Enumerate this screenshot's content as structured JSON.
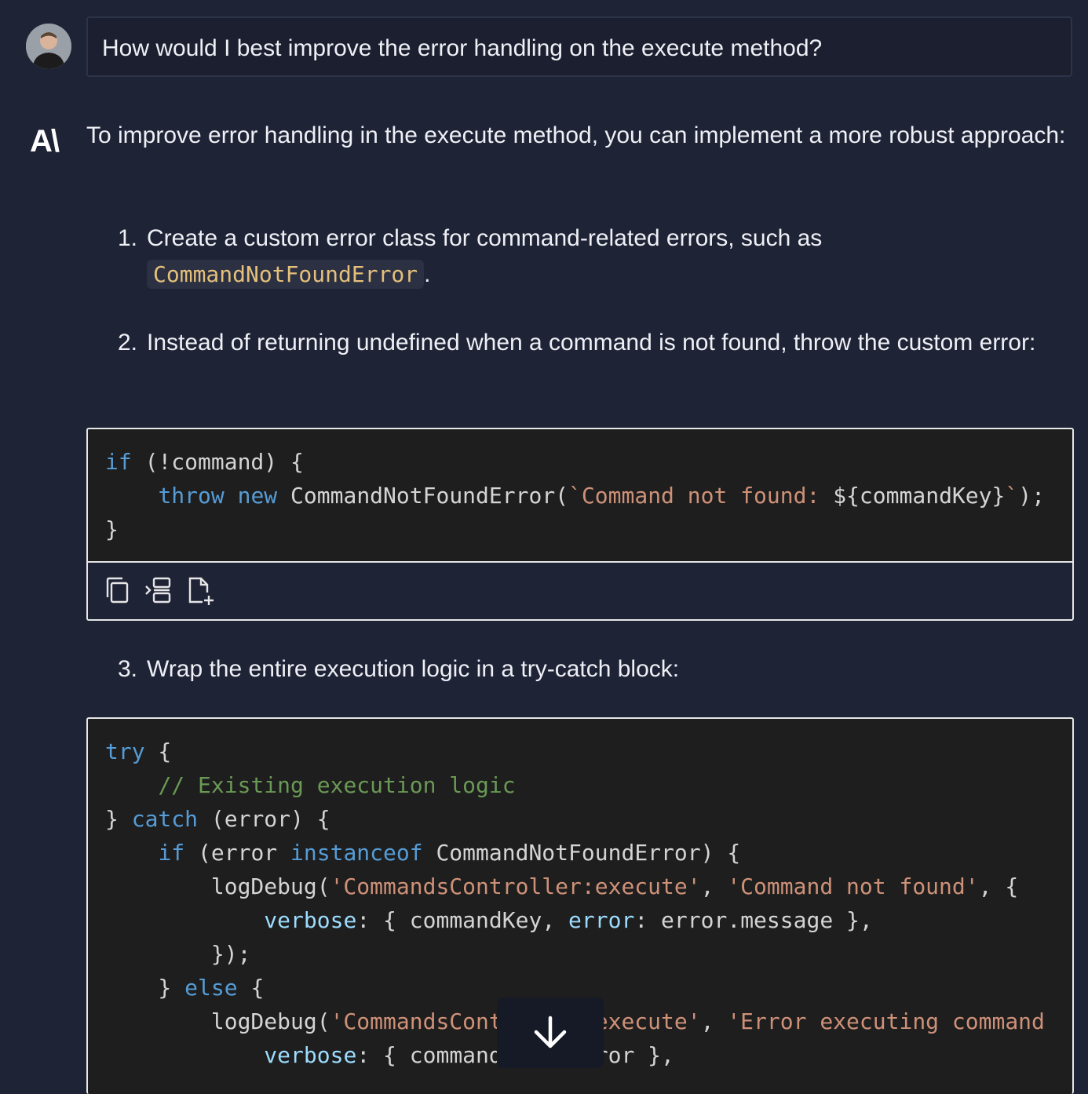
{
  "user": {
    "message": "How would I best improve the error handling on the execute method?"
  },
  "assistant": {
    "logo": "A\\",
    "intro": "To improve error handling in the execute method, you can implement a more robust approach:",
    "steps": [
      {
        "number": "1.",
        "text": "Create a custom error class for command-related errors, such as",
        "code": "CommandNotFoundError",
        "suffix": "."
      },
      {
        "number": "2.",
        "text": "Instead of returning undefined when a command is not found, throw the custom error:"
      },
      {
        "number": "3.",
        "text": "Wrap the entire execution logic in a try-catch block:"
      }
    ]
  },
  "code_blocks": [
    {
      "lines": [
        "if (!command) {",
        "    throw new CommandNotFoundError(`Command not found: ${commandKey}`);",
        "}"
      ],
      "toolbar": [
        "copy-icon",
        "insert-icon",
        "new-file-icon"
      ]
    },
    {
      "lines": [
        "try {",
        "    // Existing execution logic",
        "} catch (error) {",
        "    if (error instanceof CommandNotFoundError) {",
        "        logDebug('CommandsController:execute', 'Command not found', {",
        "            verbose: { commandKey, error: error.message },",
        "        });",
        "    } else {",
        "        logDebug('CommandsController:execute', 'Error executing command",
        "            verbose: { commandKey, error },"
      ]
    }
  ],
  "scroll_button": {
    "icon": "arrow-down-icon"
  },
  "colors": {
    "background": "#1f2336",
    "code_background": "#1e1e1e",
    "keyword": "#569cd6",
    "string": "#ce9178",
    "comment": "#6a9955",
    "property": "#9cdcfe",
    "inline_code": "#e5c07b"
  }
}
